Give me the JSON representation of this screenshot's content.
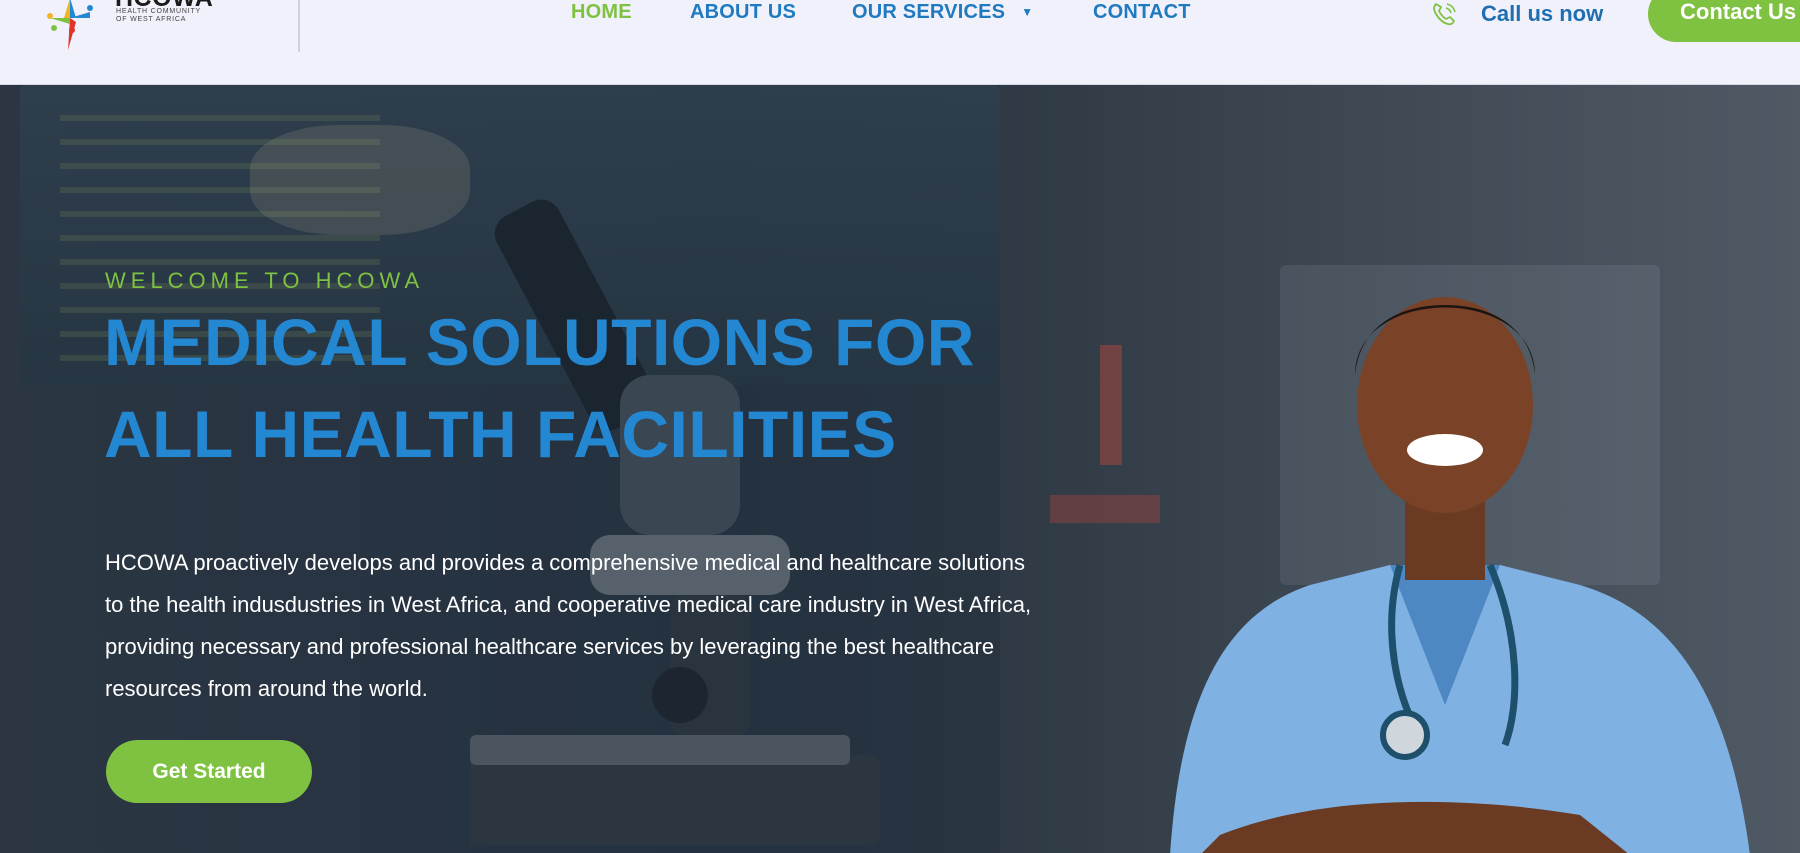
{
  "brand": {
    "name": "HCOWA",
    "tagline_line1": "HEALTH COMMUNITY",
    "tagline_line2": "OF WEST AFRICA",
    "colors": {
      "green": "#7fc241",
      "blue": "#2387d2",
      "nav_blue": "#1f7ac0",
      "header_bg": "#f1f1fc"
    }
  },
  "nav": {
    "items": [
      {
        "label": "HOME",
        "active": true
      },
      {
        "label": "ABOUT US",
        "active": false
      },
      {
        "label": "OUR SERVICES",
        "active": false,
        "dropdown": true
      },
      {
        "label": "CONTACT",
        "active": false
      }
    ],
    "call_label": "Call us now",
    "contact_button": "Contact Us",
    "icons": {
      "phone": "phone-icon",
      "dropdown": "caret-down-icon"
    }
  },
  "hero": {
    "eyebrow": "WELCOME TO HCOWA",
    "title_line1": "MEDICAL SOLUTIONS FOR",
    "title_line2": "ALL HEALTH FACILITIES",
    "description_lines": [
      "HCOWA proactively develops and provides a comprehensive medical and healthcare solutions",
      "to the health indusdustries in West Africa,  and cooperative medical care industry in West Africa,",
      "providing necessary and professional healthcare services by leveraging the best healthcare",
      "resources from around the world."
    ],
    "cta_label": "Get Started"
  }
}
